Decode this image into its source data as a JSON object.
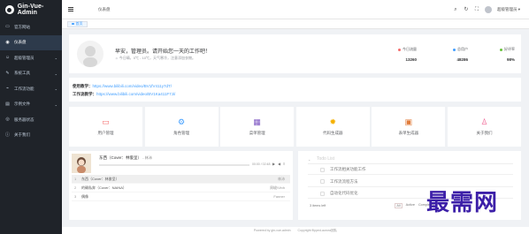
{
  "brand": {
    "name": "Gin-Vue-Admin"
  },
  "sidebar": {
    "items": [
      {
        "label": "官方网站",
        "icon": "monitor-icon",
        "glyph": "▭",
        "active": false
      },
      {
        "label": "仪表盘",
        "icon": "dashboard-icon",
        "glyph": "◉",
        "active": true
      },
      {
        "label": "超级管理员",
        "icon": "user-icon",
        "glyph": "☺",
        "active": false,
        "expandable": true
      },
      {
        "label": "系统工具",
        "icon": "tools-icon",
        "glyph": "✎",
        "active": false,
        "expandable": true
      },
      {
        "label": "工作流功能",
        "icon": "workflow-icon",
        "glyph": "⌁",
        "active": false,
        "expandable": true
      },
      {
        "label": "示例文件",
        "icon": "file-icon",
        "glyph": "▤",
        "active": false,
        "expandable": true
      },
      {
        "label": "服务器状态",
        "icon": "server-icon",
        "glyph": "◎",
        "active": false
      },
      {
        "label": "关于我们",
        "icon": "info-icon",
        "glyph": "ⓘ",
        "active": false
      }
    ]
  },
  "header": {
    "breadcrumb": "仪表盘",
    "user_name": "超级管理员",
    "user_caret": "▾"
  },
  "tabs": [
    {
      "label": "首页",
      "active": true
    }
  ],
  "welcome": {
    "greeting": "早安，管理员。请开始您一天的工作吧！",
    "weather": "今日晴，0℃ - 10℃，天气寒冷，注意添加衣物。",
    "stats": [
      {
        "label": "今日流量",
        "value": "13260",
        "color": "#f56c6c"
      },
      {
        "label": "总用户",
        "value": "48286",
        "color": "#409eff"
      },
      {
        "label": "好评率",
        "value": "98%",
        "color": "#67c23a"
      }
    ]
  },
  "links": {
    "video_label": "使用教学：",
    "video_url": "https://www.bilibili.com/video/BV1fV411y7dT/",
    "workflow_label": "工作流教学：",
    "workflow_url": "https://www.bilibili.com/video/BV1Ka411F7Ji/"
  },
  "shortcuts": [
    {
      "label": "用户管理",
      "icon": "monitor-icon",
      "glyph": "▭",
      "color": "#f56c6c"
    },
    {
      "label": "角色管理",
      "icon": "setting-icon",
      "glyph": "⚙",
      "color": "#409eff"
    },
    {
      "label": "菜单管理",
      "icon": "menu-icon",
      "glyph": "▦",
      "color": "#7e57c2"
    },
    {
      "label": "代码生成器",
      "icon": "cog-icon",
      "glyph": "✹",
      "color": "#f5b000"
    },
    {
      "label": "表单生成器",
      "icon": "form-icon",
      "glyph": "▣",
      "color": "#e07b39"
    },
    {
      "label": "关于我们",
      "icon": "user-icon",
      "glyph": "♙",
      "color": "#f06292"
    }
  ],
  "player": {
    "now_title": "东西（Cover：林俊呈）",
    "now_artist": "- 林沛",
    "time": "00:00 / 02:48",
    "controls": [
      "⏮",
      "▶",
      "⏭",
      "🔊",
      "≡"
    ],
    "playlist": [
      {
        "num": "1",
        "title": "东西（Cover：林俊呈）",
        "artist": "",
        "duration": "林沛",
        "active": true
      },
      {
        "num": "2",
        "title": "的确私奔（Cover：NAINA）",
        "artist": "",
        "duration": "周峻/Vinh",
        "active": false
      },
      {
        "num": "3",
        "title": "偶像",
        "artist": "",
        "duration": "Fanner",
        "active": false
      }
    ]
  },
  "todo": {
    "placeholder": "Todo List",
    "items": [
      "工作流相关功能工作",
      "工作流流程方法",
      "自动化代码优化"
    ],
    "count_text": "3 items left",
    "filters": [
      "All",
      "Active",
      "Completed"
    ],
    "selected_filter": "All"
  },
  "footer": {
    "powered": "Powered by gin-vue-admin",
    "copyright": "Copyright flipped-aurora团队"
  },
  "watermark": {
    "text": "最需网"
  }
}
